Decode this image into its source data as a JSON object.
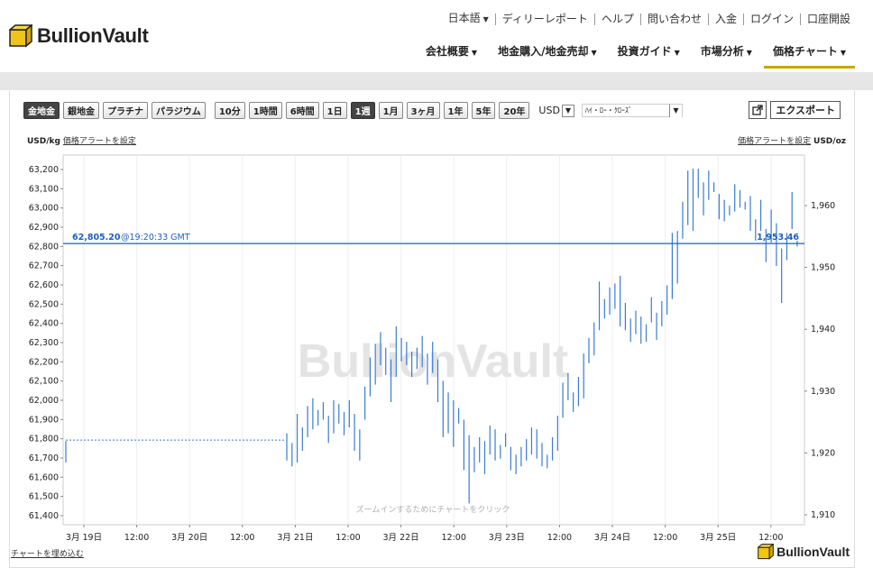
{
  "brand": {
    "name": "BullionVault",
    "accent": "#c8a600"
  },
  "top_links": [
    {
      "label": "日本語",
      "dropdown": true
    },
    {
      "label": "ディリーレポート"
    },
    {
      "label": "ヘルプ"
    },
    {
      "label": "問い合わせ"
    },
    {
      "label": "入金"
    },
    {
      "label": "ログイン"
    },
    {
      "label": "口座開設"
    }
  ],
  "main_nav": [
    {
      "label": "会社概要"
    },
    {
      "label": "地金購入/地金売却"
    },
    {
      "label": "投資ガイド"
    },
    {
      "label": "市場分析"
    },
    {
      "label": "価格チャート",
      "active": true
    }
  ],
  "metals": [
    {
      "label": "金地金",
      "active": true
    },
    {
      "label": "銀地金"
    },
    {
      "label": "プラチナ"
    },
    {
      "label": "パラジウム"
    }
  ],
  "ranges": [
    {
      "label": "10分"
    },
    {
      "label": "1時間"
    },
    {
      "label": "6時間"
    },
    {
      "label": "1日"
    },
    {
      "label": "1週",
      "active": true
    },
    {
      "label": "1月"
    },
    {
      "label": "3ヶ月"
    },
    {
      "label": "1年"
    },
    {
      "label": "5年"
    },
    {
      "label": "20年"
    }
  ],
  "currency": "USD",
  "chart_type": "ﾊｲ・ﾛｰ・ｸﾛｰｽﾞ",
  "export_label": "エクスポート",
  "left_unit": "USD/kg",
  "right_unit": "USD/oz",
  "alert_label": "価格アラートを設定",
  "embed_label": "チャートを埋め込む",
  "zoom_hint": "ズームインするためにチャートをクリック",
  "watermark": "BullionVault",
  "chart_data": {
    "type": "ohlc",
    "yleft_ticks": [
      "63,200",
      "63,100",
      "63,000",
      "62,900",
      "62,800",
      "62,700",
      "62,600",
      "62,500",
      "62,400",
      "62,300",
      "62,200",
      "62,100",
      "62,000",
      "61,900",
      "61,800",
      "61,700",
      "61,600",
      "61,500",
      "61,400"
    ],
    "yright_ticks": [
      "1,960",
      "1,950",
      "1,940",
      "1,930",
      "1,920",
      "1,910"
    ],
    "x_ticks": [
      "3月 19日",
      "12:00",
      "3月 20日",
      "12:00",
      "3月 21日",
      "12:00",
      "3月 22日",
      "12:00",
      "3月 23日",
      "12:00",
      "3月 24日",
      "12:00",
      "3月 25日",
      "12:00"
    ],
    "yleft_range": [
      61360,
      63260
    ],
    "yright_range": [
      1908,
      1966
    ],
    "current_price_kg": "62,805.20",
    "current_time": "@19:20:33 GMT",
    "current_price_oz": "1,953.46",
    "current_value_kg": 62805.2,
    "flat_value_kg": 61795,
    "line_color": "#3a7bd5",
    "bars": [
      [
        61830,
        61690
      ],
      [
        61780,
        61660
      ],
      [
        61930,
        61680
      ],
      [
        61860,
        61740
      ],
      [
        61970,
        61810
      ],
      [
        62010,
        61850
      ],
      [
        61950,
        61870
      ],
      [
        61990,
        61900
      ],
      [
        61920,
        61780
      ],
      [
        62000,
        61830
      ],
      [
        61980,
        61880
      ],
      [
        61940,
        61820
      ],
      [
        62000,
        61860
      ],
      [
        61930,
        61740
      ],
      [
        61850,
        61690
      ],
      [
        62070,
        61900
      ],
      [
        62220,
        62020
      ],
      [
        62290,
        62080
      ],
      [
        62350,
        62180
      ],
      [
        62270,
        62130
      ],
      [
        62210,
        61990
      ],
      [
        62380,
        62120
      ],
      [
        62320,
        62200
      ],
      [
        62300,
        62180
      ],
      [
        62250,
        62120
      ],
      [
        62270,
        62160
      ],
      [
        62330,
        62170
      ],
      [
        62240,
        62080
      ],
      [
        62300,
        62140
      ],
      [
        62210,
        61990
      ],
      [
        62100,
        61810
      ],
      [
        62040,
        61830
      ],
      [
        62000,
        61760
      ],
      [
        61960,
        61880
      ],
      [
        61900,
        61640
      ],
      [
        61820,
        61470
      ],
      [
        61760,
        61630
      ],
      [
        61810,
        61680
      ],
      [
        61790,
        61620
      ],
      [
        61870,
        61720
      ],
      [
        61850,
        61690
      ],
      [
        61770,
        61700
      ],
      [
        61830,
        61760
      ],
      [
        61760,
        61640
      ],
      [
        61720,
        61620
      ],
      [
        61760,
        61660
      ],
      [
        61800,
        61690
      ],
      [
        61860,
        61720
      ],
      [
        61850,
        61700
      ],
      [
        61780,
        61660
      ],
      [
        61720,
        61650
      ],
      [
        61810,
        61690
      ],
      [
        61920,
        61740
      ],
      [
        62090,
        61910
      ],
      [
        62140,
        62000
      ],
      [
        62040,
        61940
      ],
      [
        62120,
        61970
      ],
      [
        62240,
        62010
      ],
      [
        62320,
        62190
      ],
      [
        62400,
        62230
      ],
      [
        62610,
        62360
      ],
      [
        62520,
        62420
      ],
      [
        62580,
        62440
      ],
      [
        62600,
        62470
      ],
      [
        62640,
        62380
      ],
      [
        62500,
        62360
      ],
      [
        62420,
        62300
      ],
      [
        62460,
        62340
      ],
      [
        62430,
        62290
      ],
      [
        62390,
        62300
      ],
      [
        62530,
        62400
      ],
      [
        62450,
        62310
      ],
      [
        62510,
        62380
      ],
      [
        62590,
        62440
      ],
      [
        62860,
        62520
      ],
      [
        62870,
        62600
      ],
      [
        63020,
        62830
      ],
      [
        63180,
        62900
      ],
      [
        63190,
        62870
      ],
      [
        63190,
        63040
      ],
      [
        63120,
        62950
      ],
      [
        63180,
        63030
      ],
      [
        63120,
        63070
      ],
      [
        63060,
        62930
      ],
      [
        63030,
        62920
      ],
      [
        63000,
        62950
      ],
      [
        63110,
        62970
      ],
      [
        63080,
        62990
      ],
      [
        63020,
        62980
      ],
      [
        63050,
        62870
      ],
      [
        62930,
        62820
      ],
      [
        63030,
        62870
      ],
      [
        62880,
        62710
      ],
      [
        62980,
        62810
      ],
      [
        62910,
        62690
      ],
      [
        62780,
        62500
      ],
      [
        62860,
        62720
      ],
      [
        63070,
        62880
      ],
      [
        62820,
        62790
      ]
    ]
  }
}
